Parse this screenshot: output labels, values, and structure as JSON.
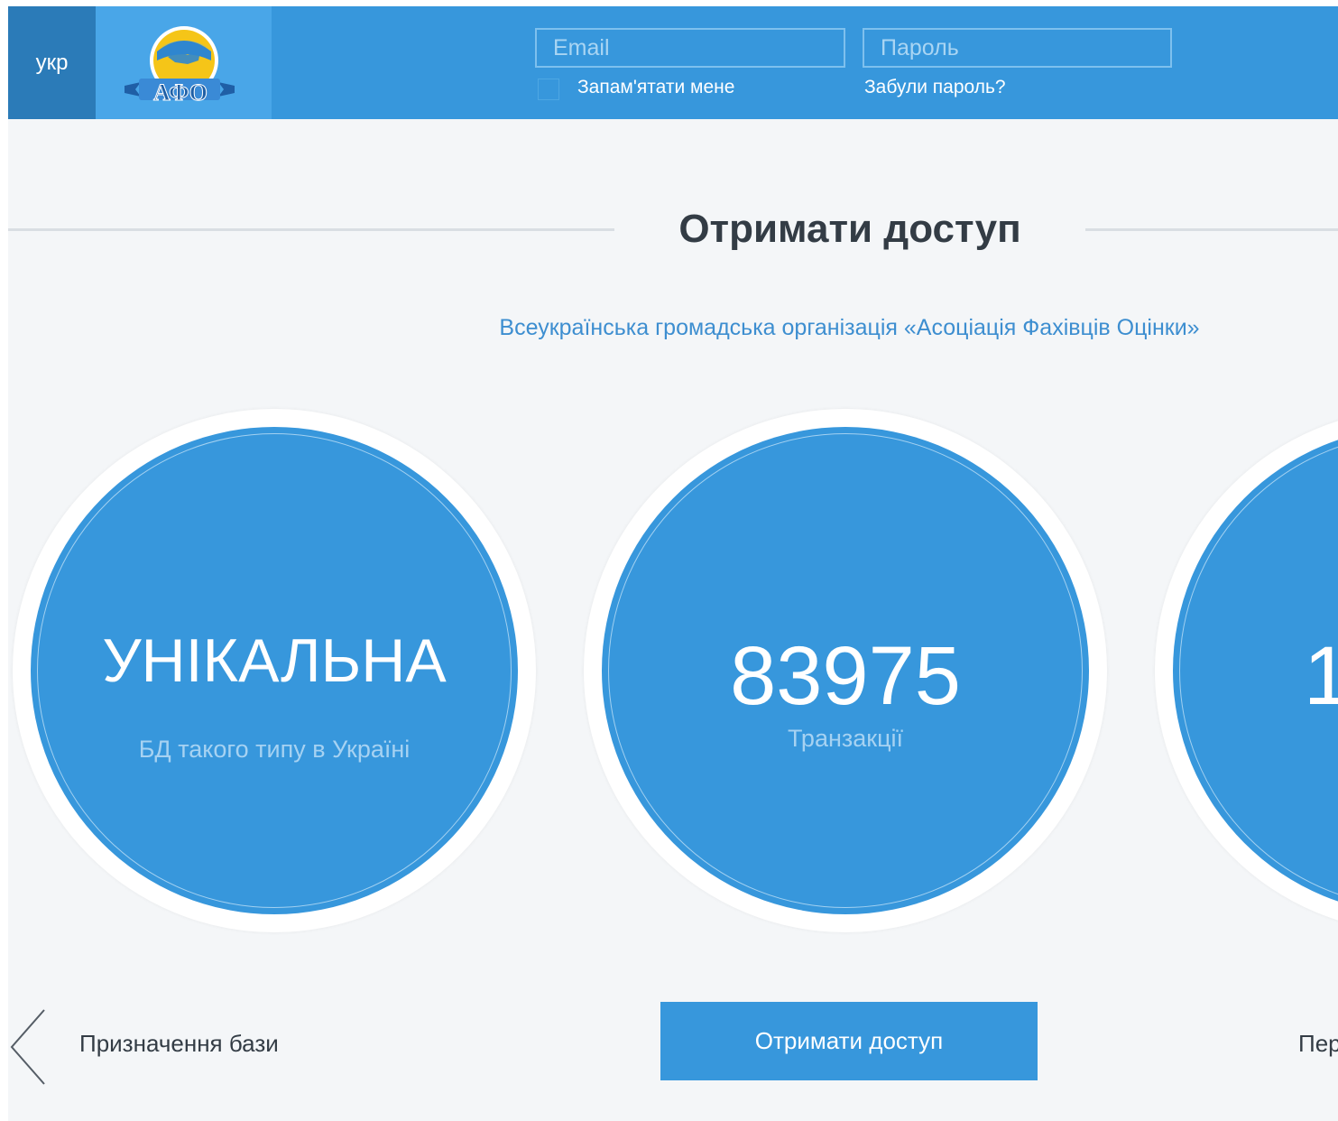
{
  "header": {
    "language": "укр",
    "logo_text": "АФО",
    "email_placeholder": "Email",
    "password_placeholder": "Пароль",
    "remember_label": "Запам'ятати мене",
    "forgot_link": "Забули пароль?"
  },
  "main": {
    "title": "Отримати доступ",
    "subtitle": "Всеукраїнська громадська організація «Асоціація Фахівців Оцінки»",
    "stats": [
      {
        "value": "УНІКАЛЬНА",
        "label": "БД такого типу в Україні"
      },
      {
        "value": "83975",
        "label": "Транзакції"
      },
      {
        "value": "1",
        "label": ""
      }
    ]
  },
  "footer_nav": {
    "prev_label": "Призначення бази",
    "cta_label": "Отримати доступ",
    "next_label": "Пер"
  },
  "colors": {
    "primary": "#3797dc",
    "header_dark": "#2b7bb8",
    "background": "#f4f6f8",
    "title_text": "#333c45",
    "subtitle_text": "#3d8ed0"
  }
}
